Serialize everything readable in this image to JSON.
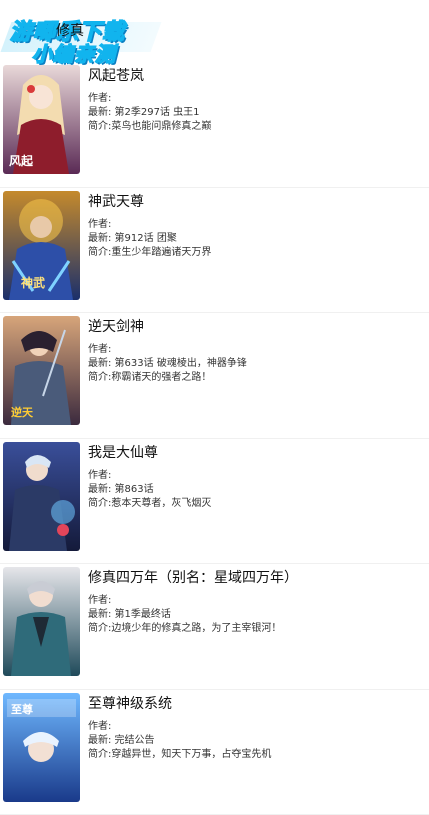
{
  "header": {
    "page_title": "修真",
    "watermark_line1": "游唧乐下载",
    "watermark_line2": "小编亲测"
  },
  "comics": [
    {
      "title": "风起苍岚",
      "author_label": "作者:",
      "latest": "最新: 第2季297话 虫王1",
      "intro": "简介:菜鸟也能问鼎修真之巅"
    },
    {
      "title": "神武天尊",
      "author_label": "作者:",
      "latest": "最新: 第912话 团聚",
      "intro": "简介:重生少年踏遍诸天万界"
    },
    {
      "title": "逆天剑神",
      "author_label": "作者:",
      "latest": "最新: 第633话 破魂棱出，神器争锋",
      "intro": "简介:称霸诸天的强者之路！"
    },
    {
      "title": "我是大仙尊",
      "author_label": "作者:",
      "latest": "最新: 第863话",
      "intro": "简介:惹本天尊者，灰飞烟灭"
    },
    {
      "title": "修真四万年（别名：星域四万年）",
      "author_label": "作者:",
      "latest": "最新: 第1季最终话",
      "intro": "简介:边境少年的修真之路，为了主宰银河！"
    },
    {
      "title": "至尊神级系统",
      "author_label": "作者:",
      "latest": "最新: 完结公告",
      "intro": "简介:穿越异世，知天下万事，占夺宝先机"
    }
  ]
}
